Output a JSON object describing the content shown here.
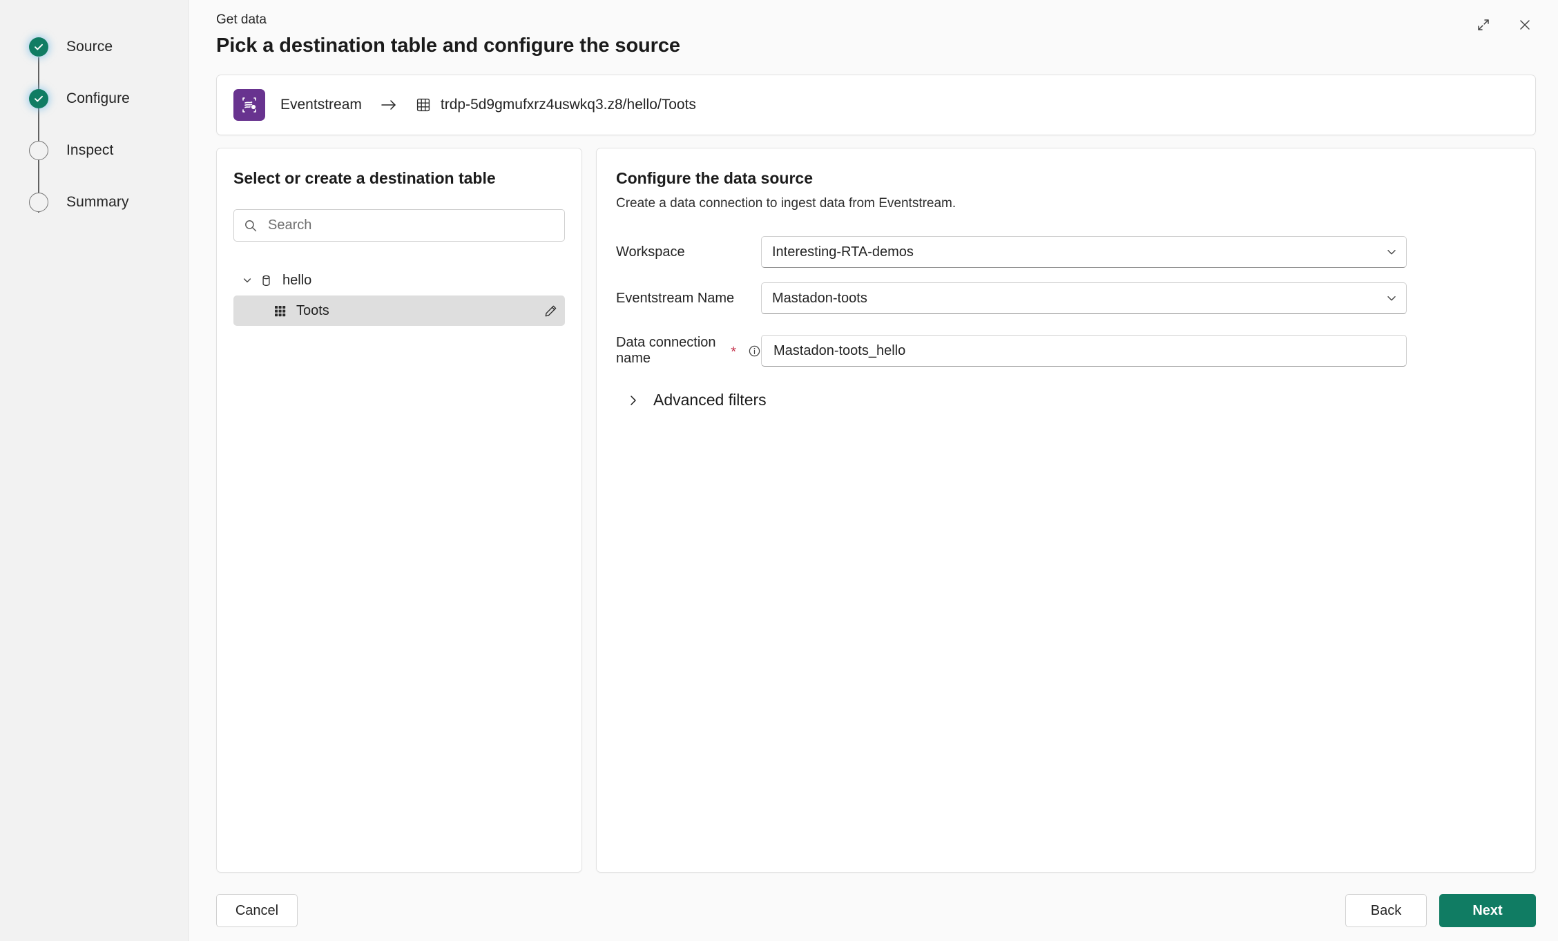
{
  "wizard": {
    "steps": [
      {
        "label": "Source",
        "state": "done"
      },
      {
        "label": "Configure",
        "state": "current"
      },
      {
        "label": "Inspect",
        "state": "todo"
      },
      {
        "label": "Summary",
        "state": "todo"
      }
    ]
  },
  "header": {
    "eyebrow": "Get data",
    "title": "Pick a destination table and configure the source",
    "expand_icon": "expand-diagonal-icon",
    "close_icon": "close-icon"
  },
  "source_chip": {
    "icon": "eventstream-icon",
    "source_label": "Eventstream",
    "arrow_icon": "arrow-right-icon",
    "dest_icon": "table-grid-icon",
    "destination_path": "trdp-5d9gmufxrz4uswkq3.z8/hello/Toots"
  },
  "left_panel": {
    "title": "Select or create a destination table",
    "search": {
      "placeholder": "Search",
      "value": "",
      "icon": "search-icon"
    },
    "tree": [
      {
        "label": "hello",
        "type": "database",
        "icon": "database-icon",
        "chevron": "chevron-down-icon",
        "expanded": true,
        "selected": false
      },
      {
        "label": "Toots",
        "type": "table",
        "icon": "table-grid-filled-icon",
        "edit_icon": "pencil-edit-icon",
        "selected": true
      }
    ]
  },
  "right_panel": {
    "title": "Configure the data source",
    "subtitle": "Create a data connection to ingest data from Eventstream.",
    "fields": [
      {
        "label": "Workspace",
        "value": "Interesting-RTA-demos",
        "control": "dropdown",
        "required": false,
        "chevron": "chevron-down-icon"
      },
      {
        "label": "Eventstream Name",
        "value": "Mastadon-toots",
        "control": "dropdown",
        "required": false,
        "chevron": "chevron-down-icon"
      },
      {
        "label": "Data connection name",
        "value": "Mastadon-toots_hello",
        "control": "text",
        "required": true,
        "required_marker": "*",
        "info_icon": "info-circle-icon"
      }
    ],
    "advanced_filters": {
      "label": "Advanced filters",
      "chevron": "chevron-right-icon",
      "expanded": false
    }
  },
  "footer": {
    "cancel_label": "Cancel",
    "back_label": "Back",
    "next_label": "Next"
  },
  "colors": {
    "accent_teal": "#107c63",
    "eventstream_purple": "#68338f",
    "required_red": "#c4314b",
    "rail_bg": "#f2f2f2",
    "main_bg": "#fafafa",
    "card_bg": "#ffffff",
    "selected_row": "#dedede"
  }
}
